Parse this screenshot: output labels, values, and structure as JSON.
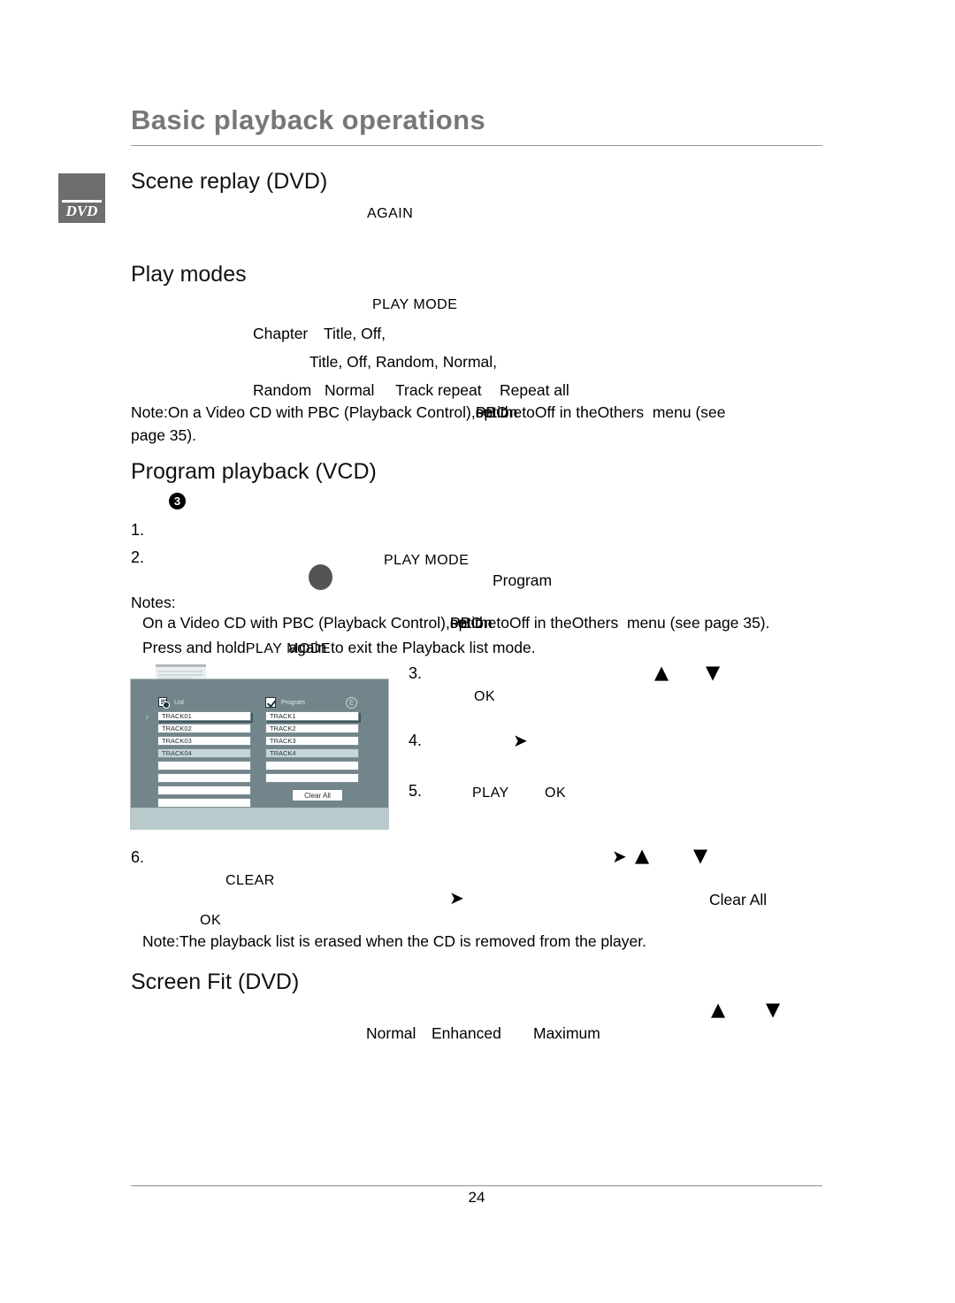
{
  "document": {
    "title": "Basic playback operations",
    "page_number": "24"
  },
  "badge": {
    "label": "DVD"
  },
  "sections": {
    "scene_replay": {
      "heading": "Scene replay (DVD)",
      "key_again": "AGAIN"
    },
    "play_modes": {
      "heading": "Play modes",
      "key_play_mode": "PLAY MODE",
      "line_chapter": "Chapter",
      "line_title_off": "Title, Off,",
      "line_options": "Title, Off, Random, Normal,",
      "opt_random": "Random",
      "opt_normal": "Normal",
      "opt_track_repeat": "Track repeat",
      "opt_repeat_all": "Repeat all",
      "note_prefix": "Note:",
      "note_a": "On a Video CD with PBC (Playback Control),",
      "note_b": "set the",
      "note_pbc": "PBC",
      "note_c": "option to",
      "note_off": "Off",
      "note_d": "in the",
      "note_others": "Others",
      "note_e": "menu (see",
      "note_f": "page 35)."
    },
    "program_playback": {
      "heading": "Program playback (VCD)",
      "bullet": "3",
      "step1": "1.",
      "step2": "2.",
      "step2_key": "PLAY MODE",
      "step2_program": "Program",
      "notes_label": "Notes:",
      "note1_a": "On a Video CD with PBC (Playback Control),",
      "note1_b": "set the",
      "note1_pbc": "PBC",
      "note1_c": "option to",
      "note1_off": "Off",
      "note1_d": "in the",
      "note1_others": "Others",
      "note1_e": "menu (see page 35).",
      "note2_a": "Press and hold",
      "note2_key": "PLAY MODE",
      "note2_b": "again to exit the Playback list mode.",
      "step3": "3.",
      "step3_ok": "OK",
      "step4": "4.",
      "step5": "5.",
      "step5_play": "PLAY",
      "step5_ok": "OK",
      "step6": "6.",
      "step6_clear": "CLEAR",
      "step6_clear_all": "Clear All",
      "step6_ok": "OK",
      "final_note": "Note:The playback list is erased when the CD is removed from the player."
    },
    "screen_fit": {
      "heading": "Screen Fit (DVD)",
      "opt_normal": "Normal",
      "opt_enhanced": "Enhanced",
      "opt_maximum": "Maximum"
    }
  },
  "program_screen": {
    "list_header": "List",
    "program_header": "Program",
    "e_badge": "E",
    "list_tracks": [
      "TRACK01",
      "TRACK02",
      "TRACK03",
      "TRACK04",
      "",
      "",
      "",
      ""
    ],
    "program_tracks": [
      "TRACK1",
      "TRACK2",
      "TRACK3",
      "TRACK4",
      "",
      ""
    ],
    "clear_all_button": "Clear All"
  },
  "glyphs": {
    "arrow_up": "▲",
    "arrow_down": "▼",
    "arrow_right": "➤"
  },
  "colors": {
    "title_gray": "#77777a",
    "badge_gray": "#6e6e6e",
    "screen_bg": "#72858a",
    "screen_footer": "#b9cacd",
    "track_dim": "#c6d5d6"
  }
}
